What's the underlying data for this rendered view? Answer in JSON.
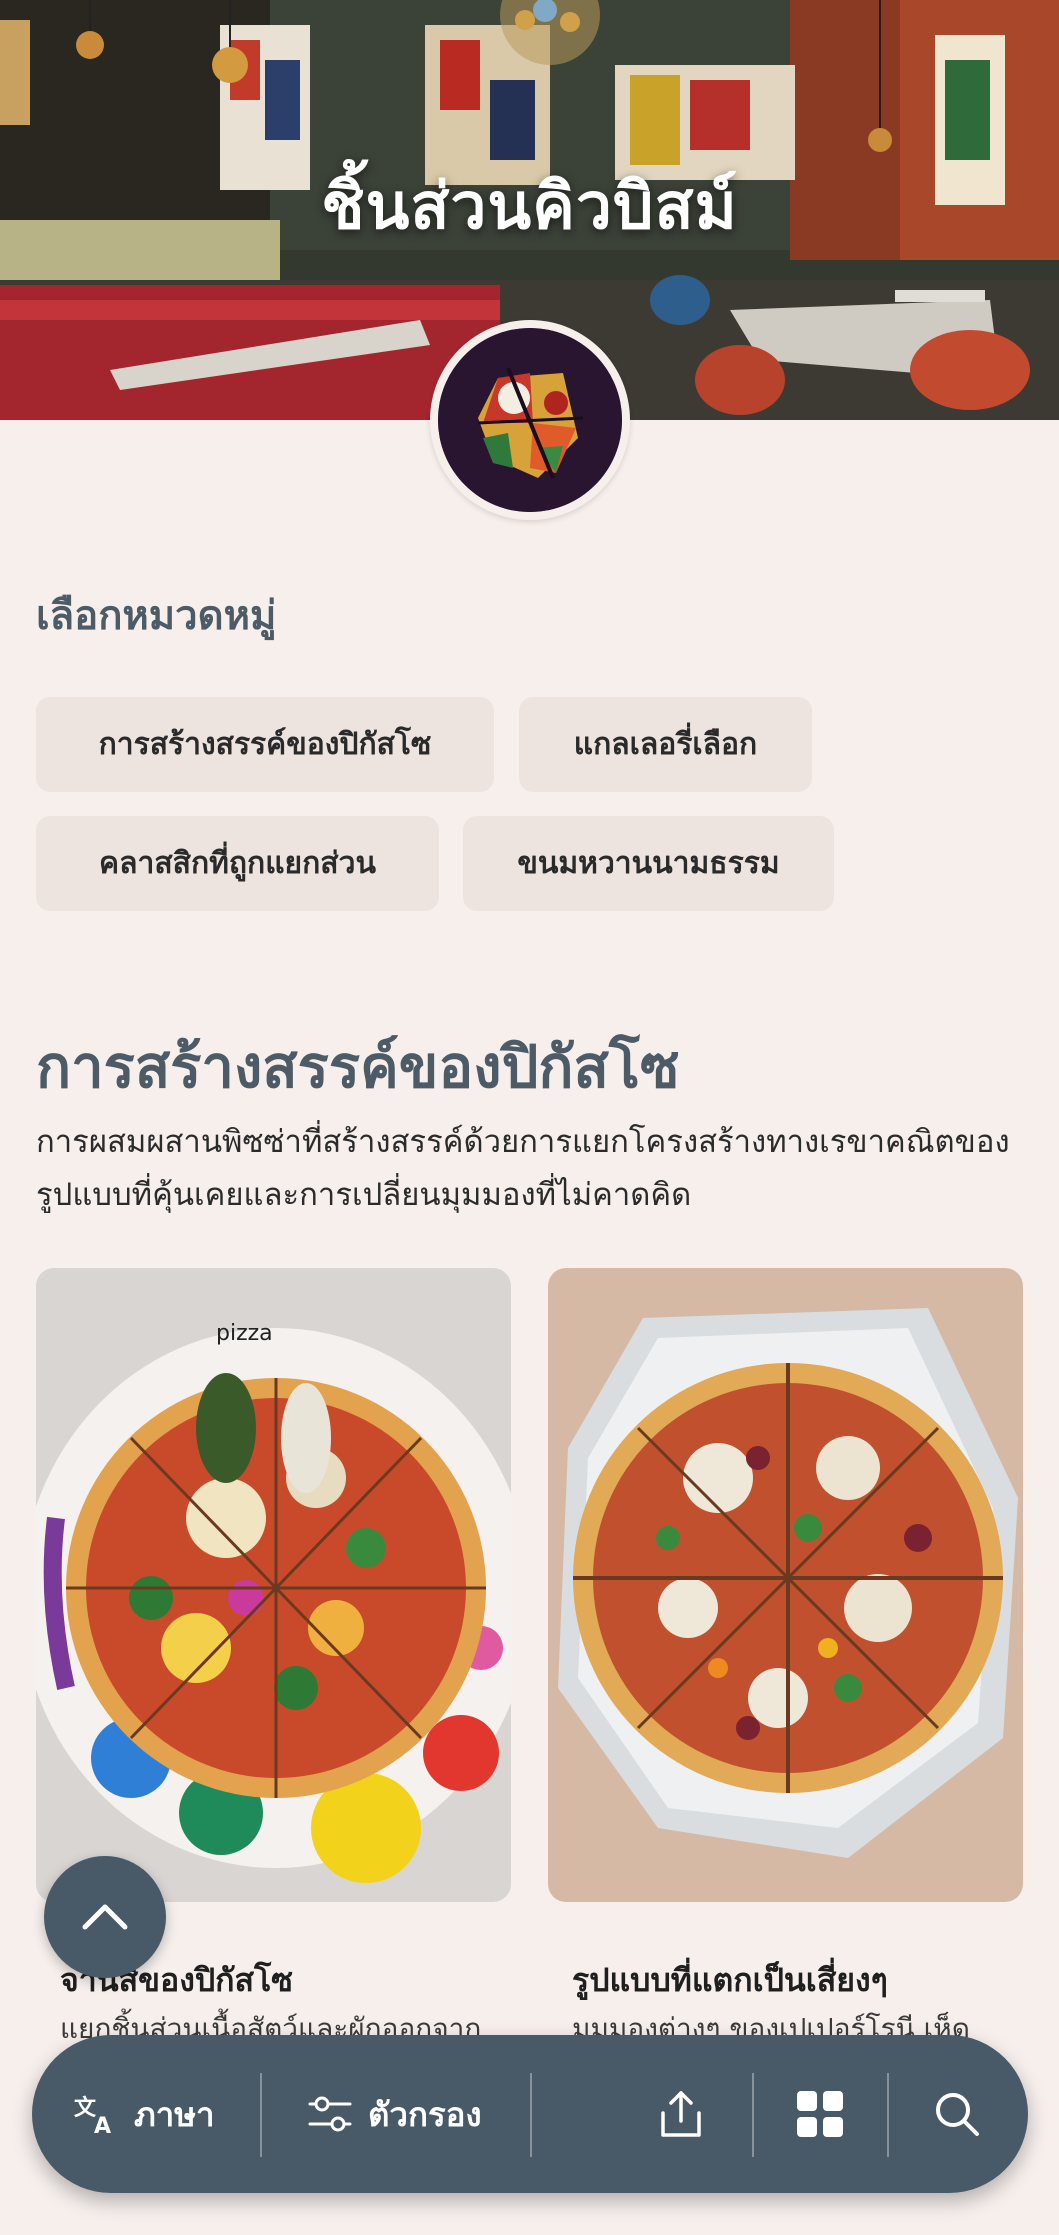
{
  "hero": {
    "title": "ชิ้นส่วนคิวบิสม์"
  },
  "category": {
    "heading": "เลือกหมวดหมู่",
    "chips": [
      "การสร้างสรรค์ของปิกัสโซ",
      "แกลเลอรี่เลือก",
      "คลาสสิกที่ถูกแยกส่วน",
      "ขนมหวานนามธรรม"
    ]
  },
  "section": {
    "title": "การสร้างสรรค์ของปิกัสโซ",
    "description": "การผสมผสานพิซซ่าที่สร้างสรรค์ด้วยการแยกโครงสร้างทางเรขาคณิตของรูปแบบที่คุ้นเคยและการเปลี่ยนมุมมองที่ไม่คาดคิด"
  },
  "cards": [
    {
      "title": "จานสีของปิกัสโซ",
      "description": "แยกชิ้นส่วนเนื้อสัตว์และผักออกจาก",
      "image_icon": "pizza-palette-image"
    },
    {
      "title": "รูปแบบที่แตกเป็นเสี่ยงๆ",
      "description": "มุมมองต่างๆ ของเปเปอร์โรนี เห็ด",
      "image_icon": "pizza-box-image"
    }
  ],
  "bottom_bar": {
    "language_label": "ภาษา",
    "filter_label": "ตัวกรอง",
    "icons": [
      "translate-icon",
      "filter-icon",
      "share-icon",
      "grid-icon",
      "search-icon"
    ]
  },
  "colors": {
    "background": "#f6efec",
    "accent": "#485a67",
    "heading": "#4d5b67",
    "chip": "#ede4e0"
  }
}
